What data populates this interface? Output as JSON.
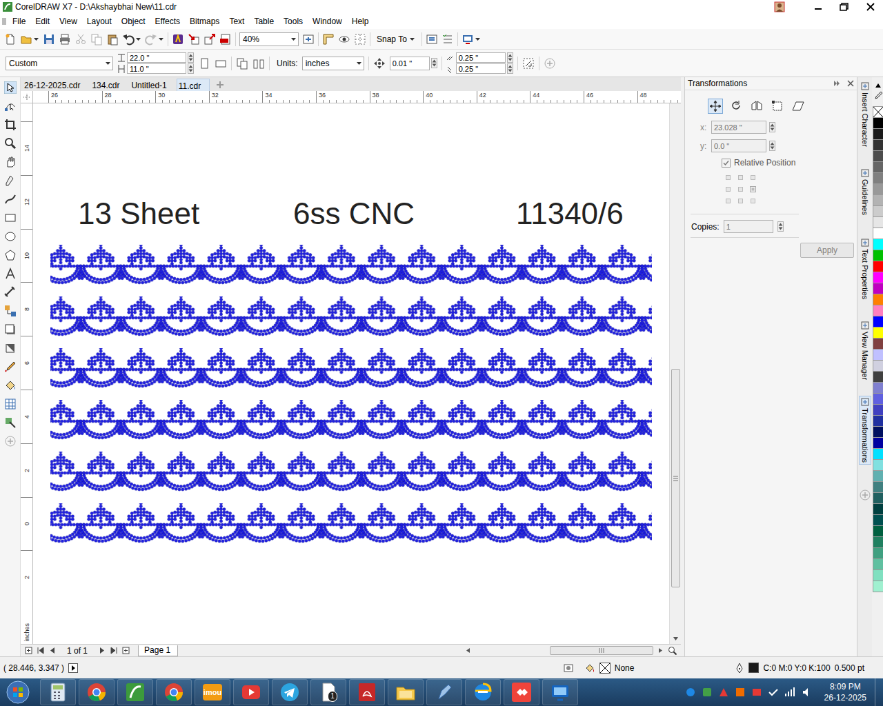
{
  "window": {
    "title": "CorelDRAW X7 - D:\\Akshaybhai New\\11.cdr"
  },
  "menu": [
    "File",
    "Edit",
    "View",
    "Layout",
    "Object",
    "Effects",
    "Bitmaps",
    "Text",
    "Table",
    "Tools",
    "Window",
    "Help"
  ],
  "toolbar": {
    "zoom": "40%",
    "snap_to": "Snap To"
  },
  "property_bar": {
    "page_size": "Custom",
    "width": "22.0 \"",
    "height": "11.0 \"",
    "units_label": "Units:",
    "units": "inches",
    "nudge": "0.01 \"",
    "duplicate_x": "0.25 \"",
    "duplicate_y": "0.25 \""
  },
  "document_tabs": [
    {
      "label": "26-12-2025.cdr",
      "selected": false
    },
    {
      "label": "134.cdr",
      "selected": false
    },
    {
      "label": "Untitled-1",
      "selected": false
    },
    {
      "label": "11.cdr",
      "selected": true
    }
  ],
  "rulers": {
    "horizontal": [
      "26",
      "28",
      "30",
      "32",
      "34",
      "36",
      "38",
      "40",
      "42",
      "44",
      "46",
      "48"
    ],
    "horizontal_unit": "inches",
    "vertical": [
      "14",
      "12",
      "10",
      "8",
      "6",
      "4",
      "2",
      "0",
      "2"
    ],
    "vertical_unit": "inches"
  },
  "canvas": {
    "texts": [
      "13 Sheet",
      "6ss CNC",
      "11340/6"
    ],
    "pattern_rows": [
      {
        "repeats": 15
      },
      {
        "repeats": 15
      },
      {
        "repeats": 15
      },
      {
        "repeats": 15
      },
      {
        "repeats": 15
      },
      {
        "repeats": 15
      }
    ]
  },
  "page_nav": {
    "count": "1 of 1",
    "page_tab": "Page 1"
  },
  "docker": {
    "title": "Transformations",
    "modes": [
      {
        "selected": true
      },
      {
        "selected": false
      },
      {
        "selected": false
      },
      {
        "selected": false
      },
      {
        "selected": false
      }
    ],
    "x_label": "x:",
    "x": "23.028 \"",
    "y_label": "y:",
    "y": "0.0 \"",
    "fields_disabled": true,
    "relative_position": {
      "label": "Relative Position",
      "checked": true
    },
    "copies_label": "Copies:",
    "copies": "1",
    "apply": {
      "label": "Apply",
      "disabled": true
    }
  },
  "side_tabs": [
    {
      "label": "Insert Character",
      "selected": false
    },
    {
      "label": "Guidelines",
      "selected": false
    },
    {
      "label": "Text Properties",
      "selected": false
    },
    {
      "label": "View Manager",
      "selected": false
    },
    {
      "label": "Transformations",
      "selected": true
    }
  ],
  "palette": [
    {
      "color": "#000000"
    },
    {
      "color": "#1a1a1a"
    },
    {
      "color": "#333333"
    },
    {
      "color": "#4d4d4d"
    },
    {
      "color": "#666666"
    },
    {
      "color": "#808080"
    },
    {
      "color": "#999999"
    },
    {
      "color": "#b3b3b3"
    },
    {
      "color": "#cccccc"
    },
    {
      "color": "#e6e6e6"
    },
    {
      "color": "#ffffff"
    },
    {
      "color": "#00ffff"
    },
    {
      "color": "#00c000"
    },
    {
      "color": "#ff0000"
    },
    {
      "color": "#ff00ff"
    },
    {
      "color": "#c000c0"
    },
    {
      "color": "#ff8000"
    },
    {
      "color": "#ff80c0"
    },
    {
      "color": "#0000ff"
    },
    {
      "color": "#ffff00"
    },
    {
      "color": "#804040"
    },
    {
      "color": "#c0c0ff"
    },
    {
      "color": "#d0d0e0"
    },
    {
      "color": "#404040"
    },
    {
      "color": "#8080d0"
    },
    {
      "color": "#6060e0"
    },
    {
      "color": "#4040c0"
    },
    {
      "color": "#2030a0"
    },
    {
      "color": "#001060"
    },
    {
      "color": "#0000a0"
    },
    {
      "color": "#00e0ff"
    },
    {
      "color": "#80e0e0"
    },
    {
      "color": "#60b0b0"
    },
    {
      "color": "#408080"
    },
    {
      "color": "#206060"
    },
    {
      "color": "#004040"
    },
    {
      "color": "#005050"
    },
    {
      "color": "#006040"
    },
    {
      "color": "#208060"
    },
    {
      "color": "#40a080"
    },
    {
      "color": "#60c0a0"
    },
    {
      "color": "#80e0c0"
    },
    {
      "color": "#a0f0d0"
    }
  ],
  "status_bar": {
    "coordinates": "( 28.446, 3.347 )",
    "fill": "None",
    "outline": "C:0 M:0 Y:0 K:100",
    "outline_width": "0.500 pt"
  },
  "taskbar": {
    "apps": [
      {
        "kind": "calculator"
      },
      {
        "kind": "chrome"
      },
      {
        "kind": "coreldraw"
      },
      {
        "kind": "chrome"
      },
      {
        "kind": "imou",
        "label": "imou"
      },
      {
        "kind": "media"
      },
      {
        "kind": "telegram"
      },
      {
        "kind": "document",
        "label": "1"
      },
      {
        "kind": "pdf"
      },
      {
        "kind": "folder"
      },
      {
        "kind": "pen"
      },
      {
        "kind": "browser"
      },
      {
        "kind": "anydesk"
      },
      {
        "kind": "remote"
      }
    ],
    "time": "8:09 PM",
    "date": "26-12-2025"
  }
}
